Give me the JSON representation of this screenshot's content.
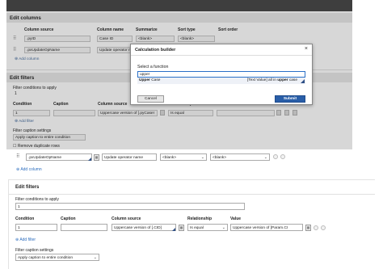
{
  "top": {
    "edit_columns_title": "Edit columns",
    "col_headers": [
      "Column source",
      "Column name",
      "Summarize",
      "Sort type",
      "Sort order"
    ],
    "rows": [
      {
        "source": ".pyID",
        "name": "Case ID",
        "summarize": "<blank>",
        "sort": "<blank>"
      },
      {
        "source": ".pxUpdateOpName",
        "name": "Update operator name",
        "summarize": "<blank>",
        "sort": "<blank>"
      }
    ],
    "add_column": "Add column",
    "edit_filters_title": "Edit filters",
    "filter_conditions_label": "Filter conditions to apply",
    "filter_conditions_value": "1",
    "filter_headers": [
      "Condition",
      "Caption",
      "Column source",
      "Relationship",
      "Value"
    ],
    "filter_row": {
      "condition": "1",
      "caption": "",
      "source": "Uppercase version of [.pyCaseI",
      "relationship": "Is equal",
      "value": ""
    },
    "add_filter": "Add filter",
    "caption_settings_label": "Filter caption settings",
    "caption_settings_value": "Apply caption to entire condition",
    "remove_duplicate": "Remove duplicate rows"
  },
  "modal": {
    "title": "Calculation builder",
    "close": "×",
    "label": "Select a function",
    "input_value": "upper",
    "suggestion_name_bold": "Upper",
    "suggestion_name_rest": " Case",
    "suggestion_desc_pre": "[Text Value] all in ",
    "suggestion_desc_bold": "upper",
    "suggestion_desc_post": " case",
    "cancel": "Cancel",
    "submit": "Submit"
  },
  "mid": {
    "source": ".pxUpdateOpName",
    "name": "Update operator name",
    "summarize": "<blank>",
    "sort": "<blank>",
    "add_column": "Add column"
  },
  "bottom": {
    "title": "Edit filters",
    "filter_conditions_label": "Filter conditions to apply",
    "filter_conditions_value": "1",
    "headers": {
      "condition": "Condition",
      "caption": "Caption",
      "source": "Column source",
      "relationship": "Relationship",
      "value": "Value"
    },
    "row": {
      "condition": "1",
      "caption": "",
      "source": "Uppercase version of [.CID]",
      "relationship": "Is equal",
      "value": "Uppercase version of [Param.CI"
    },
    "add_filter": "Add filter",
    "caption_settings_label": "Filter caption settings",
    "caption_settings_value": "Apply caption to entire condition"
  },
  "icons": {
    "calc": "calculator-icon",
    "grip": "drag-handle-icon",
    "remove": "remove-circle-icon",
    "plus": "plus-icon"
  }
}
